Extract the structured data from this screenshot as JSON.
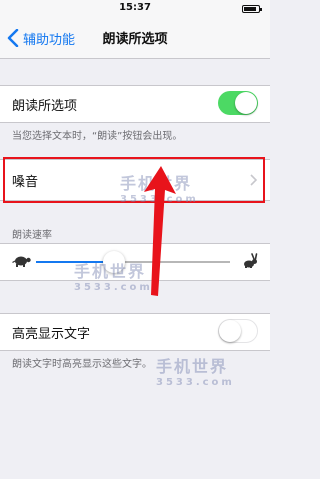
{
  "status_bar": {
    "time": "15:37"
  },
  "nav": {
    "back_label": "辅助功能",
    "title": "朗读所选项"
  },
  "speak_selection": {
    "label": "朗读所选项",
    "toggle_on": true,
    "footer": "当您选择文本时，“朗读”按钮会出现。"
  },
  "voices": {
    "label": "嗓音"
  },
  "speaking_rate": {
    "header": "朗读速率",
    "value_fraction": 0.4
  },
  "highlight_words": {
    "label": "高亮显示文字",
    "toggle_on": false,
    "footer": "朗读文字时高亮显示这些文字。"
  },
  "watermark": {
    "text": "手机世界",
    "subtext": "3533.com"
  },
  "colors": {
    "accent": "#1478f0",
    "toggle_on": "#4cd964",
    "annotation_red": "#e8131b"
  }
}
